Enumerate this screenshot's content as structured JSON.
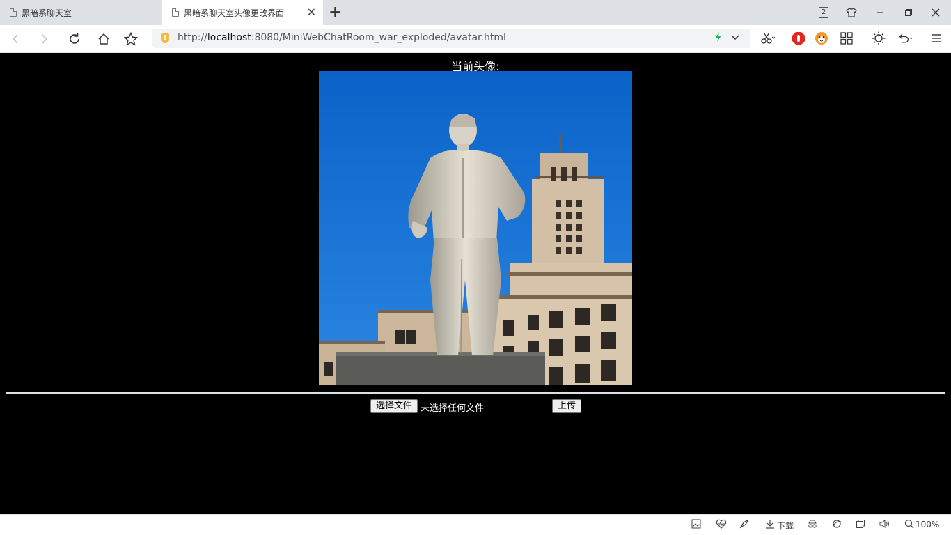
{
  "tabs": [
    {
      "title": "黑暗系聊天室",
      "active": false
    },
    {
      "title": "黑暗系聊天室头像更改界面",
      "active": true
    }
  ],
  "tab_count": "2",
  "address": {
    "scheme": "http://",
    "host": "localhost",
    "rest": ":8080/MiniWebChatRoom_war_exploded/avatar.html"
  },
  "page": {
    "current_avatar_label": "当前头像:",
    "choose_file_label": "选择文件",
    "no_file_text": "未选择任何文件",
    "upload_label": "上传"
  },
  "statusbar": {
    "download_label": "下载",
    "zoom": "100%"
  },
  "colors": {
    "page_bg": "#000000",
    "accent_green": "#19b955",
    "shield": "#f5b940"
  }
}
